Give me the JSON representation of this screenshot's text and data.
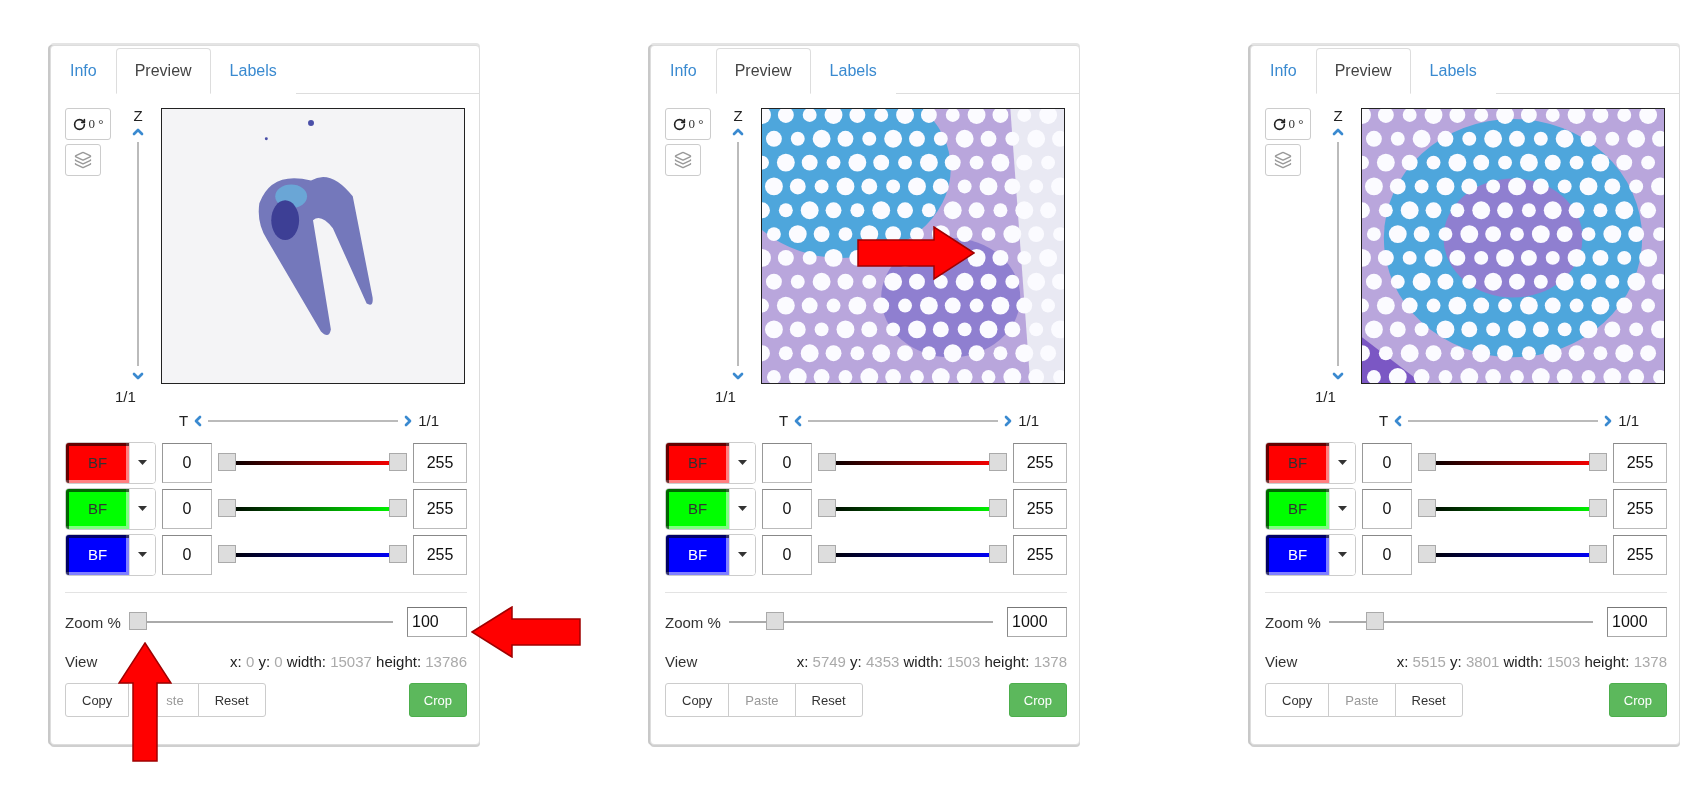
{
  "panels": [
    {
      "tabs": [
        {
          "label": "Info",
          "selected": false
        },
        {
          "label": "Preview",
          "selected": true
        },
        {
          "label": "Labels",
          "selected": false
        }
      ],
      "rotation": "0 °",
      "z": {
        "label": "Z",
        "value": "1/1"
      },
      "t": {
        "label": "T",
        "value": "1/1"
      },
      "channels": [
        {
          "name": "BF",
          "color": "#ff0000",
          "min": "0",
          "max": "255",
          "handles": [
            {
              "level": 0
            },
            {
              "level": 1
            }
          ]
        },
        {
          "name": "BF",
          "color": "#00ff00",
          "min": "0",
          "max": "255",
          "handles": [
            {
              "level": 0
            },
            {
              "level": 1
            }
          ]
        },
        {
          "name": "BF",
          "color": "#0000ff",
          "min": "0",
          "max": "255",
          "handles": [
            {
              "level": 0
            },
            {
              "level": 1
            }
          ]
        }
      ],
      "zoom": {
        "label": "Zoom %",
        "level": 0,
        "value": "100"
      },
      "view": {
        "label": "View",
        "fields": [
          {
            "label": "x:",
            "value": "0"
          },
          {
            "label": "y:",
            "value": "0"
          },
          {
            "label": "width:",
            "value": "15037"
          },
          {
            "label": "height:",
            "value": "13786"
          }
        ]
      },
      "buttons": [
        {
          "label": "Copy",
          "disabled": false
        },
        {
          "label": "ste",
          "disabled": true
        },
        {
          "label": "Reset",
          "disabled": false
        }
      ],
      "crop": "Crop",
      "arrows": [
        {
          "kind": "left"
        },
        {
          "kind": "up"
        }
      ]
    },
    {
      "tabs": [
        {
          "label": "Info",
          "selected": false
        },
        {
          "label": "Preview",
          "selected": true
        },
        {
          "label": "Labels",
          "selected": false
        }
      ],
      "rotation": "0 °",
      "z": {
        "label": "Z",
        "value": "1/1"
      },
      "t": {
        "label": "T",
        "value": "1/1"
      },
      "channels": [
        {
          "name": "BF",
          "color": "#ff0000",
          "min": "0",
          "max": "255",
          "handles": [
            {
              "level": 0
            },
            {
              "level": 1
            }
          ]
        },
        {
          "name": "BF",
          "color": "#00ff00",
          "min": "0",
          "max": "255",
          "handles": [
            {
              "level": 0
            },
            {
              "level": 1
            }
          ]
        },
        {
          "name": "BF",
          "color": "#0000ff",
          "min": "0",
          "max": "255",
          "handles": [
            {
              "level": 0
            },
            {
              "level": 1
            }
          ]
        }
      ],
      "zoom": {
        "label": "Zoom %",
        "level": 0.15,
        "value": "1000"
      },
      "view": {
        "label": "View",
        "fields": [
          {
            "label": "x:",
            "value": "5749"
          },
          {
            "label": "y:",
            "value": "4353"
          },
          {
            "label": "width:",
            "value": "1503"
          },
          {
            "label": "height:",
            "value": "1378"
          }
        ]
      },
      "buttons": [
        {
          "label": "Copy",
          "disabled": false
        },
        {
          "label": "Paste",
          "disabled": true
        },
        {
          "label": "Reset",
          "disabled": false
        }
      ],
      "crop": "Crop",
      "arrows": [
        {
          "kind": "right"
        }
      ]
    },
    {
      "tabs": [
        {
          "label": "Info",
          "selected": false
        },
        {
          "label": "Preview",
          "selected": true
        },
        {
          "label": "Labels",
          "selected": false
        }
      ],
      "rotation": "0 °",
      "z": {
        "label": "Z",
        "value": "1/1"
      },
      "t": {
        "label": "T",
        "value": "1/1"
      },
      "channels": [
        {
          "name": "BF",
          "color": "#ff0000",
          "min": "0",
          "max": "255",
          "handles": [
            {
              "level": 0
            },
            {
              "level": 1
            }
          ]
        },
        {
          "name": "BF",
          "color": "#00ff00",
          "min": "0",
          "max": "255",
          "handles": [
            {
              "level": 0
            },
            {
              "level": 1
            }
          ]
        },
        {
          "name": "BF",
          "color": "#0000ff",
          "min": "0",
          "max": "255",
          "handles": [
            {
              "level": 0
            },
            {
              "level": 1
            }
          ]
        }
      ],
      "zoom": {
        "label": "Zoom %",
        "level": 0.15,
        "value": "1000"
      },
      "view": {
        "label": "View",
        "fields": [
          {
            "label": "x:",
            "value": "5515"
          },
          {
            "label": "y:",
            "value": "3801"
          },
          {
            "label": "width:",
            "value": "1503"
          },
          {
            "label": "height:",
            "value": "1378"
          }
        ]
      },
      "buttons": [
        {
          "label": "Copy",
          "disabled": false
        },
        {
          "label": "Paste",
          "disabled": true
        },
        {
          "label": "Reset",
          "disabled": false
        }
      ],
      "crop": "Crop"
    }
  ]
}
